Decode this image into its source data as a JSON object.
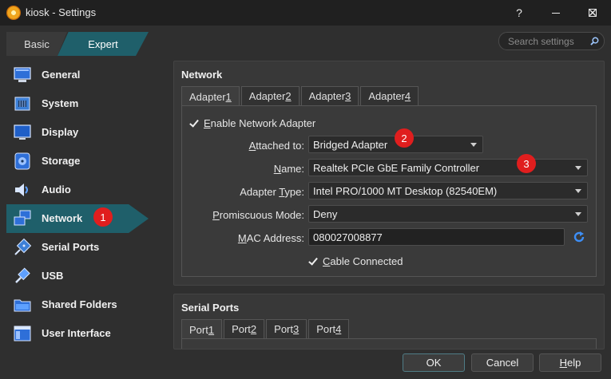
{
  "window": {
    "title": "kiosk - Settings",
    "help": "?",
    "close": "✕"
  },
  "mode": {
    "basic": "Basic",
    "expert": "Expert"
  },
  "search": {
    "placeholder": "Search settings"
  },
  "sidebar": {
    "items": [
      {
        "label": "General"
      },
      {
        "label": "System"
      },
      {
        "label": "Display"
      },
      {
        "label": "Storage"
      },
      {
        "label": "Audio"
      },
      {
        "label": "Network"
      },
      {
        "label": "Serial Ports"
      },
      {
        "label": "USB"
      },
      {
        "label": "Shared Folders"
      },
      {
        "label": "User Interface"
      }
    ]
  },
  "network": {
    "title": "Network",
    "tabs": [
      {
        "pre": "Adapter ",
        "key": "1"
      },
      {
        "pre": "Adapter ",
        "key": "2"
      },
      {
        "pre": "Adapter ",
        "key": "3"
      },
      {
        "pre": "Adapter ",
        "key": "4"
      }
    ],
    "enable": {
      "key": "E",
      "rest": "nable Network Adapter"
    },
    "attached": {
      "key": "A",
      "rest": "ttached to:",
      "value": "Bridged Adapter"
    },
    "name": {
      "key": "N",
      "rest": "ame:",
      "value": "Realtek PCIe GbE Family Controller"
    },
    "adapter_type": {
      "pre": "Adapter ",
      "key": "T",
      "rest": "ype:",
      "value": "Intel PRO/1000 MT Desktop (82540EM)"
    },
    "promiscuous": {
      "key": "P",
      "rest": "romiscuous Mode:",
      "value": "Deny"
    },
    "mac": {
      "key": "M",
      "rest": "AC Address:",
      "value": "080027008877"
    },
    "cable": {
      "key": "C",
      "rest": "able Connected"
    }
  },
  "serial": {
    "title": "Serial Ports",
    "tabs": [
      {
        "pre": "Port ",
        "key": "1"
      },
      {
        "pre": "Port ",
        "key": "2"
      },
      {
        "pre": "Port ",
        "key": "3"
      },
      {
        "pre": "Port ",
        "key": "4"
      }
    ]
  },
  "badges": [
    "1",
    "2",
    "3"
  ],
  "buttons": {
    "ok": "OK",
    "cancel": "Cancel",
    "help_key": "H",
    "help_rest": "elp"
  },
  "colors": {
    "accent": "#1f5f6a",
    "badge": "#e01e1e"
  }
}
